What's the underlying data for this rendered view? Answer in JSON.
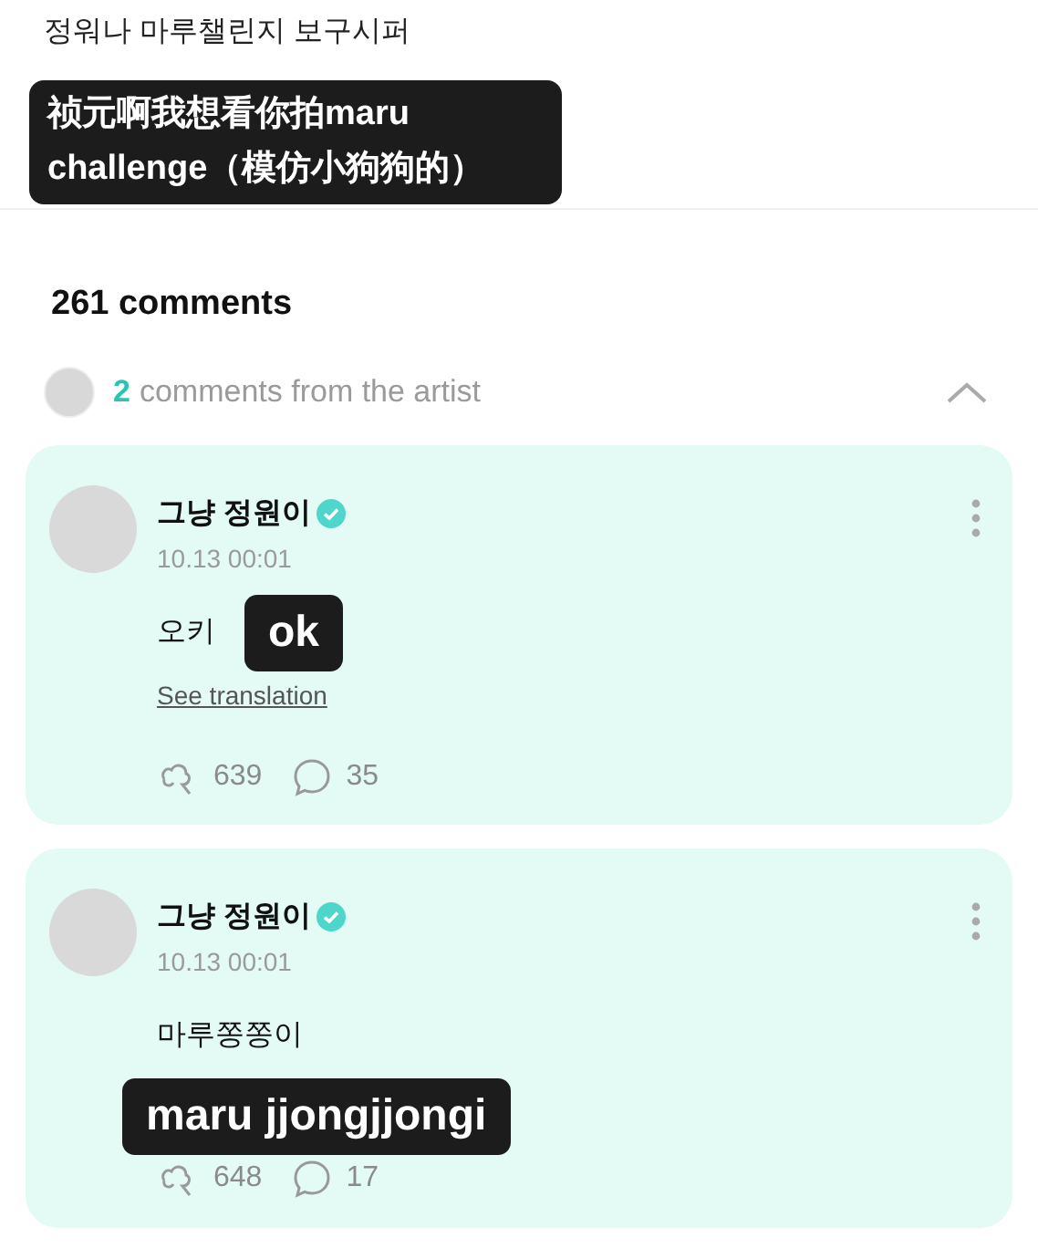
{
  "post": {
    "text": "정워나 마루챌린지 보구시퍼",
    "caption": "祯元啊我想看你拍maru challenge（模仿小狗狗的）"
  },
  "comments_header": {
    "count_label": "261 comments",
    "artist_count": "2",
    "artist_label": "comments from the artist",
    "expanded": true
  },
  "comments": [
    {
      "author": "그냥 정원이",
      "time": "10.13 00:01",
      "text": "오키",
      "inline_caption": "ok",
      "see_translation": "See translation",
      "likes": "639",
      "replies": "35"
    },
    {
      "author": "그냥 정원이",
      "time": "10.13 00:01",
      "text": "마루쫑쫑이",
      "overlay_caption": "maru jjongjjongi",
      "likes": "648",
      "replies": "17"
    }
  ]
}
